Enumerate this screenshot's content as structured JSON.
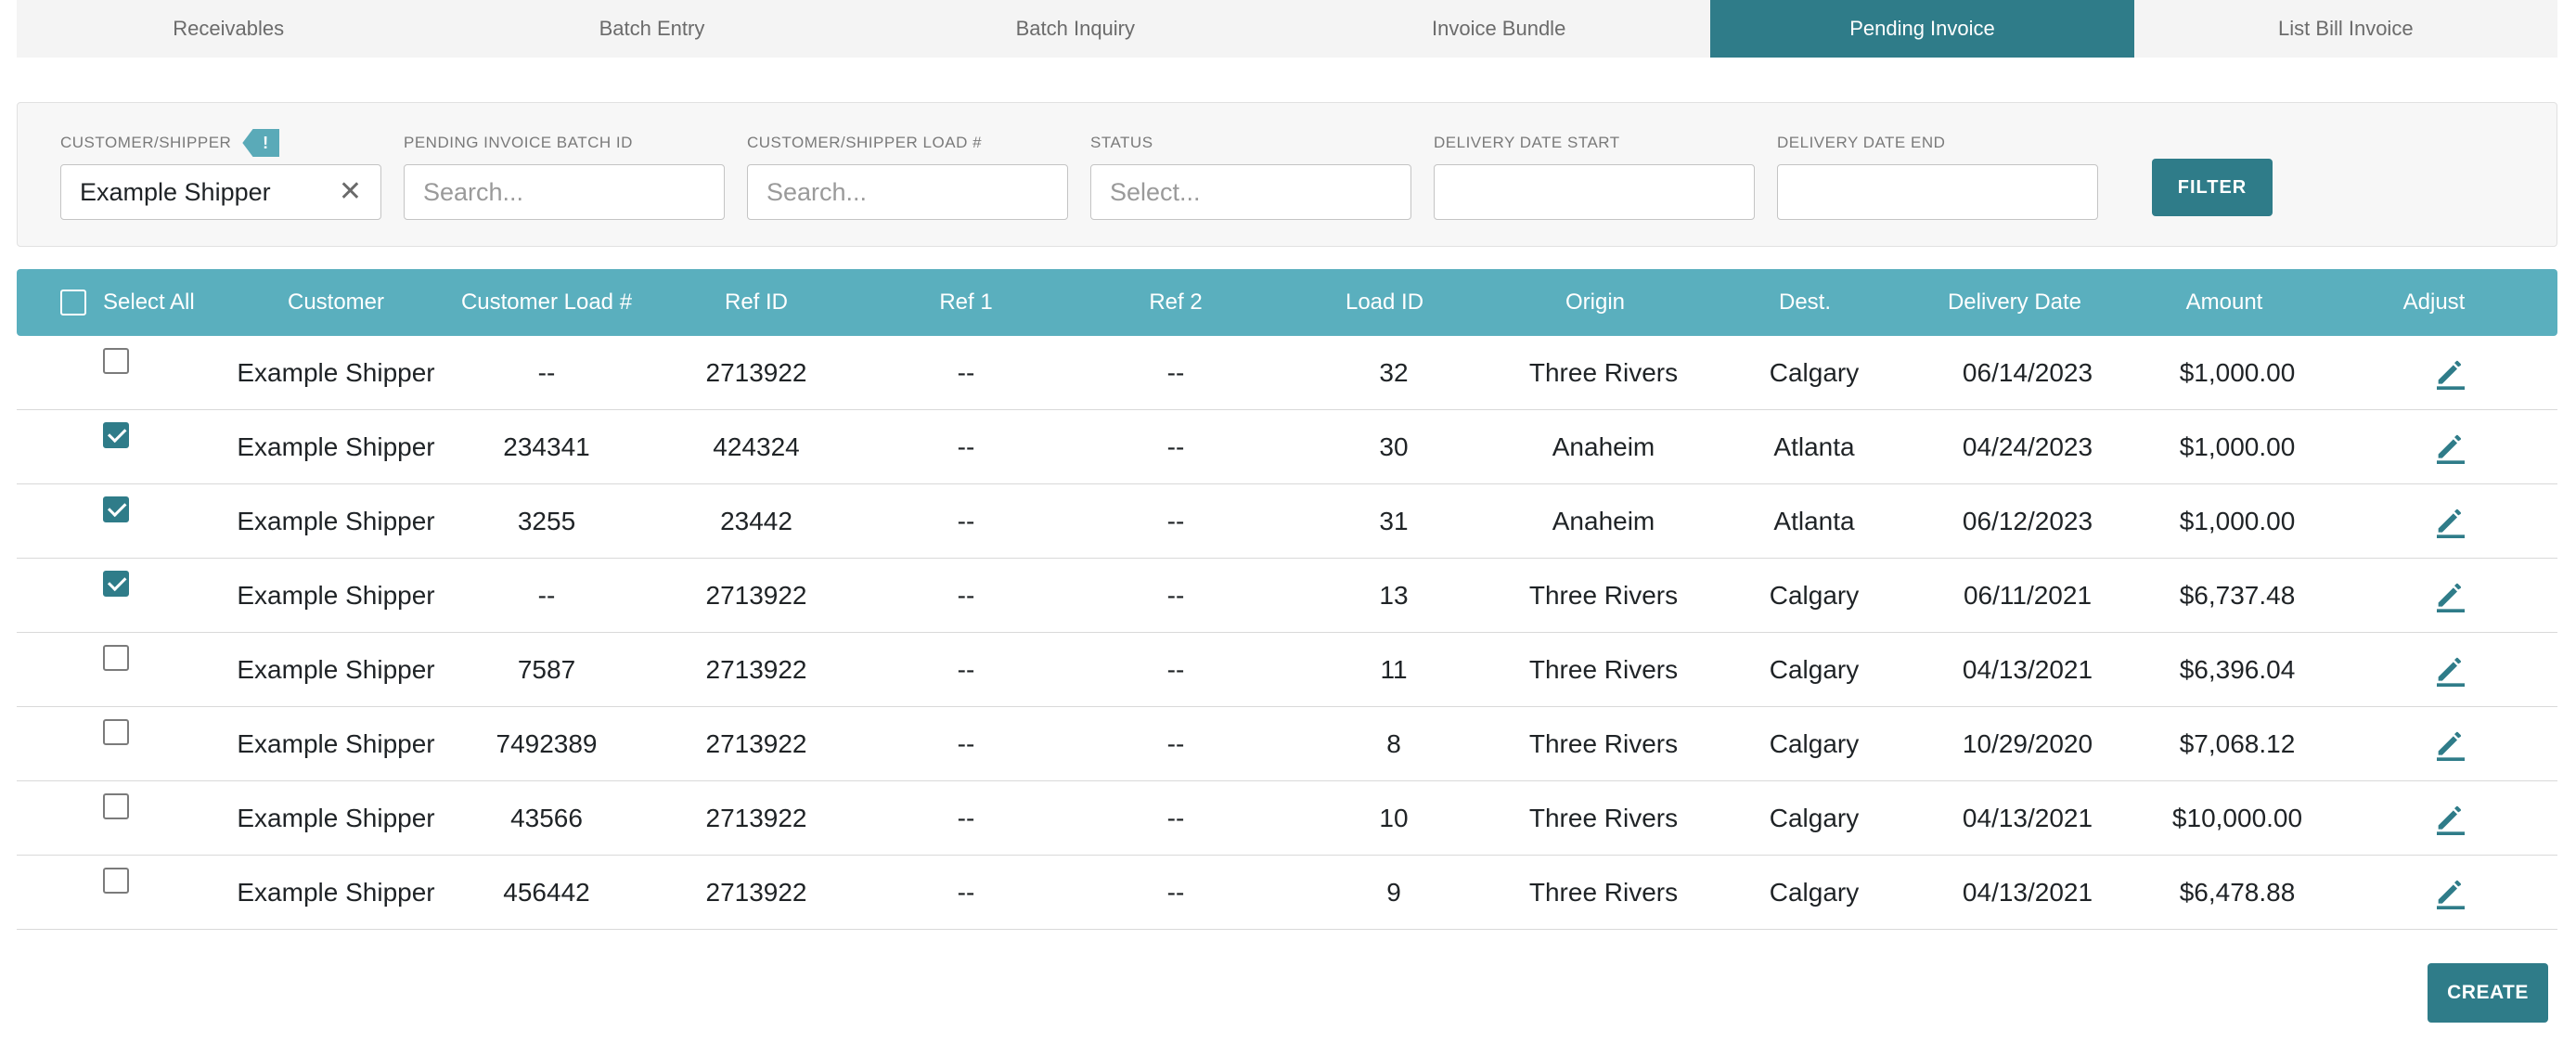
{
  "tabs": [
    {
      "label": "Receivables",
      "active": false
    },
    {
      "label": "Batch Entry",
      "active": false
    },
    {
      "label": "Batch Inquiry",
      "active": false
    },
    {
      "label": "Invoice Bundle",
      "active": false
    },
    {
      "label": "Pending Invoice",
      "active": true
    },
    {
      "label": "List Bill Invoice",
      "active": false
    }
  ],
  "filters": {
    "customer_shipper": {
      "label": "CUSTOMER/SHIPPER",
      "badge": "!",
      "value": "Example Shipper"
    },
    "batch_id": {
      "label": "PENDING INVOICE BATCH ID",
      "placeholder": "Search..."
    },
    "load_number": {
      "label": "CUSTOMER/SHIPPER LOAD #",
      "placeholder": "Search..."
    },
    "status": {
      "label": "STATUS",
      "placeholder": "Select..."
    },
    "date_start": {
      "label": "DELIVERY DATE START",
      "value": ""
    },
    "date_end": {
      "label": "DELIVERY DATE END",
      "value": ""
    },
    "filter_button": "FILTER"
  },
  "table": {
    "headers": {
      "select_all": "Select All",
      "customer": "Customer",
      "customer_load": "Customer Load #",
      "ref_id": "Ref ID",
      "ref1": "Ref 1",
      "ref2": "Ref 2",
      "load_id": "Load ID",
      "origin": "Origin",
      "dest": "Dest.",
      "delivery_date": "Delivery Date",
      "amount": "Amount",
      "adjust": "Adjust"
    },
    "rows": [
      {
        "checked": false,
        "customer": "Example Shipper",
        "customer_load": "--",
        "ref_id": "2713922",
        "ref1": "--",
        "ref2": "--",
        "load_id": "32",
        "origin": "Three Rivers",
        "dest": "Calgary",
        "delivery_date": "06/14/2023",
        "amount": "$1,000.00"
      },
      {
        "checked": true,
        "customer": "Example Shipper",
        "customer_load": "234341",
        "ref_id": "424324",
        "ref1": "--",
        "ref2": "--",
        "load_id": "30",
        "origin": "Anaheim",
        "dest": "Atlanta",
        "delivery_date": "04/24/2023",
        "amount": "$1,000.00"
      },
      {
        "checked": true,
        "customer": "Example Shipper",
        "customer_load": "3255",
        "ref_id": "23442",
        "ref1": "--",
        "ref2": "--",
        "load_id": "31",
        "origin": "Anaheim",
        "dest": "Atlanta",
        "delivery_date": "06/12/2023",
        "amount": "$1,000.00"
      },
      {
        "checked": true,
        "customer": "Example Shipper",
        "customer_load": "--",
        "ref_id": "2713922",
        "ref1": "--",
        "ref2": "--",
        "load_id": "13",
        "origin": "Three Rivers",
        "dest": "Calgary",
        "delivery_date": "06/11/2021",
        "amount": "$6,737.48"
      },
      {
        "checked": false,
        "customer": "Example Shipper",
        "customer_load": "7587",
        "ref_id": "2713922",
        "ref1": "--",
        "ref2": "--",
        "load_id": "11",
        "origin": "Three Rivers",
        "dest": "Calgary",
        "delivery_date": "04/13/2021",
        "amount": "$6,396.04"
      },
      {
        "checked": false,
        "customer": "Example Shipper",
        "customer_load": "7492389",
        "ref_id": "2713922",
        "ref1": "--",
        "ref2": "--",
        "load_id": "8",
        "origin": "Three Rivers",
        "dest": "Calgary",
        "delivery_date": "10/29/2020",
        "amount": "$7,068.12"
      },
      {
        "checked": false,
        "customer": "Example Shipper",
        "customer_load": "43566",
        "ref_id": "2713922",
        "ref1": "--",
        "ref2": "--",
        "load_id": "10",
        "origin": "Three Rivers",
        "dest": "Calgary",
        "delivery_date": "04/13/2021",
        "amount": "$10,000.00"
      },
      {
        "checked": false,
        "customer": "Example Shipper",
        "customer_load": "456442",
        "ref_id": "2713922",
        "ref1": "--",
        "ref2": "--",
        "load_id": "9",
        "origin": "Three Rivers",
        "dest": "Calgary",
        "delivery_date": "04/13/2021",
        "amount": "$6,478.88"
      }
    ]
  },
  "actions": {
    "create_button": "CREATE"
  },
  "icons": {
    "row_action": "pencil-edit-icon",
    "clear": "close-icon",
    "warning": "exclamation-badge-icon"
  },
  "colors": {
    "accent": "#2f7c89",
    "header": "#5aafbe",
    "tab_bg": "#f4f4f4"
  }
}
